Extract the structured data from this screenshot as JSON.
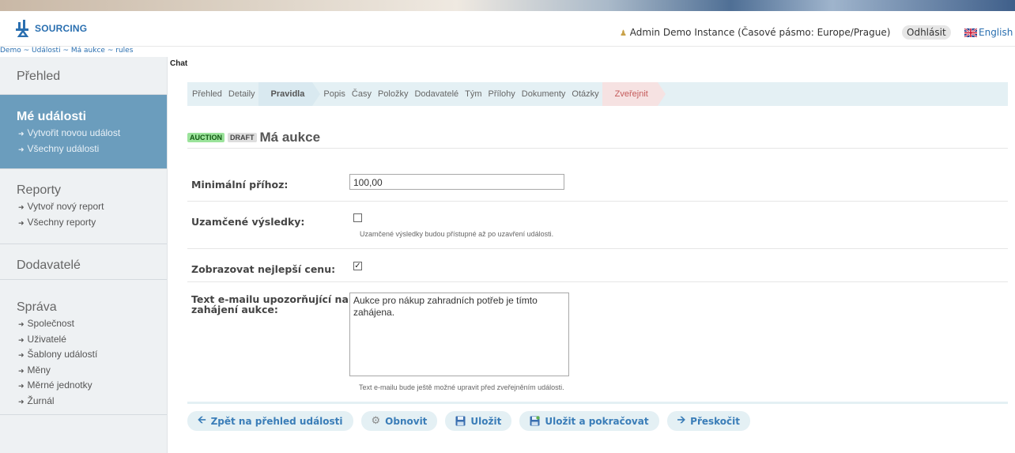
{
  "header": {
    "logo_text": "SOURCING",
    "user_info": "Admin Demo Instance (Časové pásmo: Europe/Prague)",
    "logout_label": "Odhlásit",
    "language_label": "English"
  },
  "breadcrumb": {
    "items": [
      "Demo",
      "Události",
      "Má aukce",
      "rules"
    ],
    "separator": "~"
  },
  "sidebar": {
    "overview": "Přehled",
    "my_events": {
      "title": "Mé události",
      "links": [
        "Vytvořit novou událost",
        "Všechny události"
      ]
    },
    "reports": {
      "title": "Reporty",
      "links": [
        "Vytvoř nový report",
        "Všechny reporty"
      ]
    },
    "suppliers": "Dodavatelé",
    "admin": {
      "title": "Správa",
      "links": [
        "Společnost",
        "Uživatelé",
        "Šablony událostí",
        "Měny",
        "Měrné jednotky",
        "Žurnál"
      ]
    }
  },
  "chat_label": "Chat",
  "wizard": {
    "steps": [
      "Přehled",
      "Detaily",
      "Pravidla",
      "Popis",
      "Časy",
      "Položky",
      "Dodavatelé",
      "Tým",
      "Přílohy",
      "Dokumenty",
      "Otázky",
      "Zveřejnit"
    ],
    "current": "Pravidla"
  },
  "event": {
    "badge_type": "AUCTION",
    "badge_status": "DRAFT",
    "title": "Má aukce"
  },
  "form": {
    "min_bid_label": "Minimální příhoz:",
    "min_bid_value": "100,00",
    "locked_results_label": "Uzamčené výsledky:",
    "locked_results_checked": false,
    "locked_results_hint": "Uzamčené výsledky budou přístupné až po uzavření události.",
    "show_best_price_label": "Zobrazovat nejlepší cenu:",
    "show_best_price_checked": true,
    "email_text_label": "Text e-mailu upozorňující na zahájení aukce:",
    "email_text_value": "Aukce pro nákup zahradních potřeb je tímto zahájena.",
    "email_text_hint": "Text e-mailu bude ještě možné upravit před zveřejněním události."
  },
  "actions": {
    "back": "Zpět na přehled události",
    "refresh": "Obnovit",
    "save": "Uložit",
    "save_continue": "Uložit a pokračovat",
    "skip": "Přeskočit"
  },
  "colors": {
    "accent": "#3a7db8",
    "sidebar_active": "#6b9dbd",
    "wizard_bg": "#e4f0f4",
    "publish_step": "#c45b5b"
  }
}
